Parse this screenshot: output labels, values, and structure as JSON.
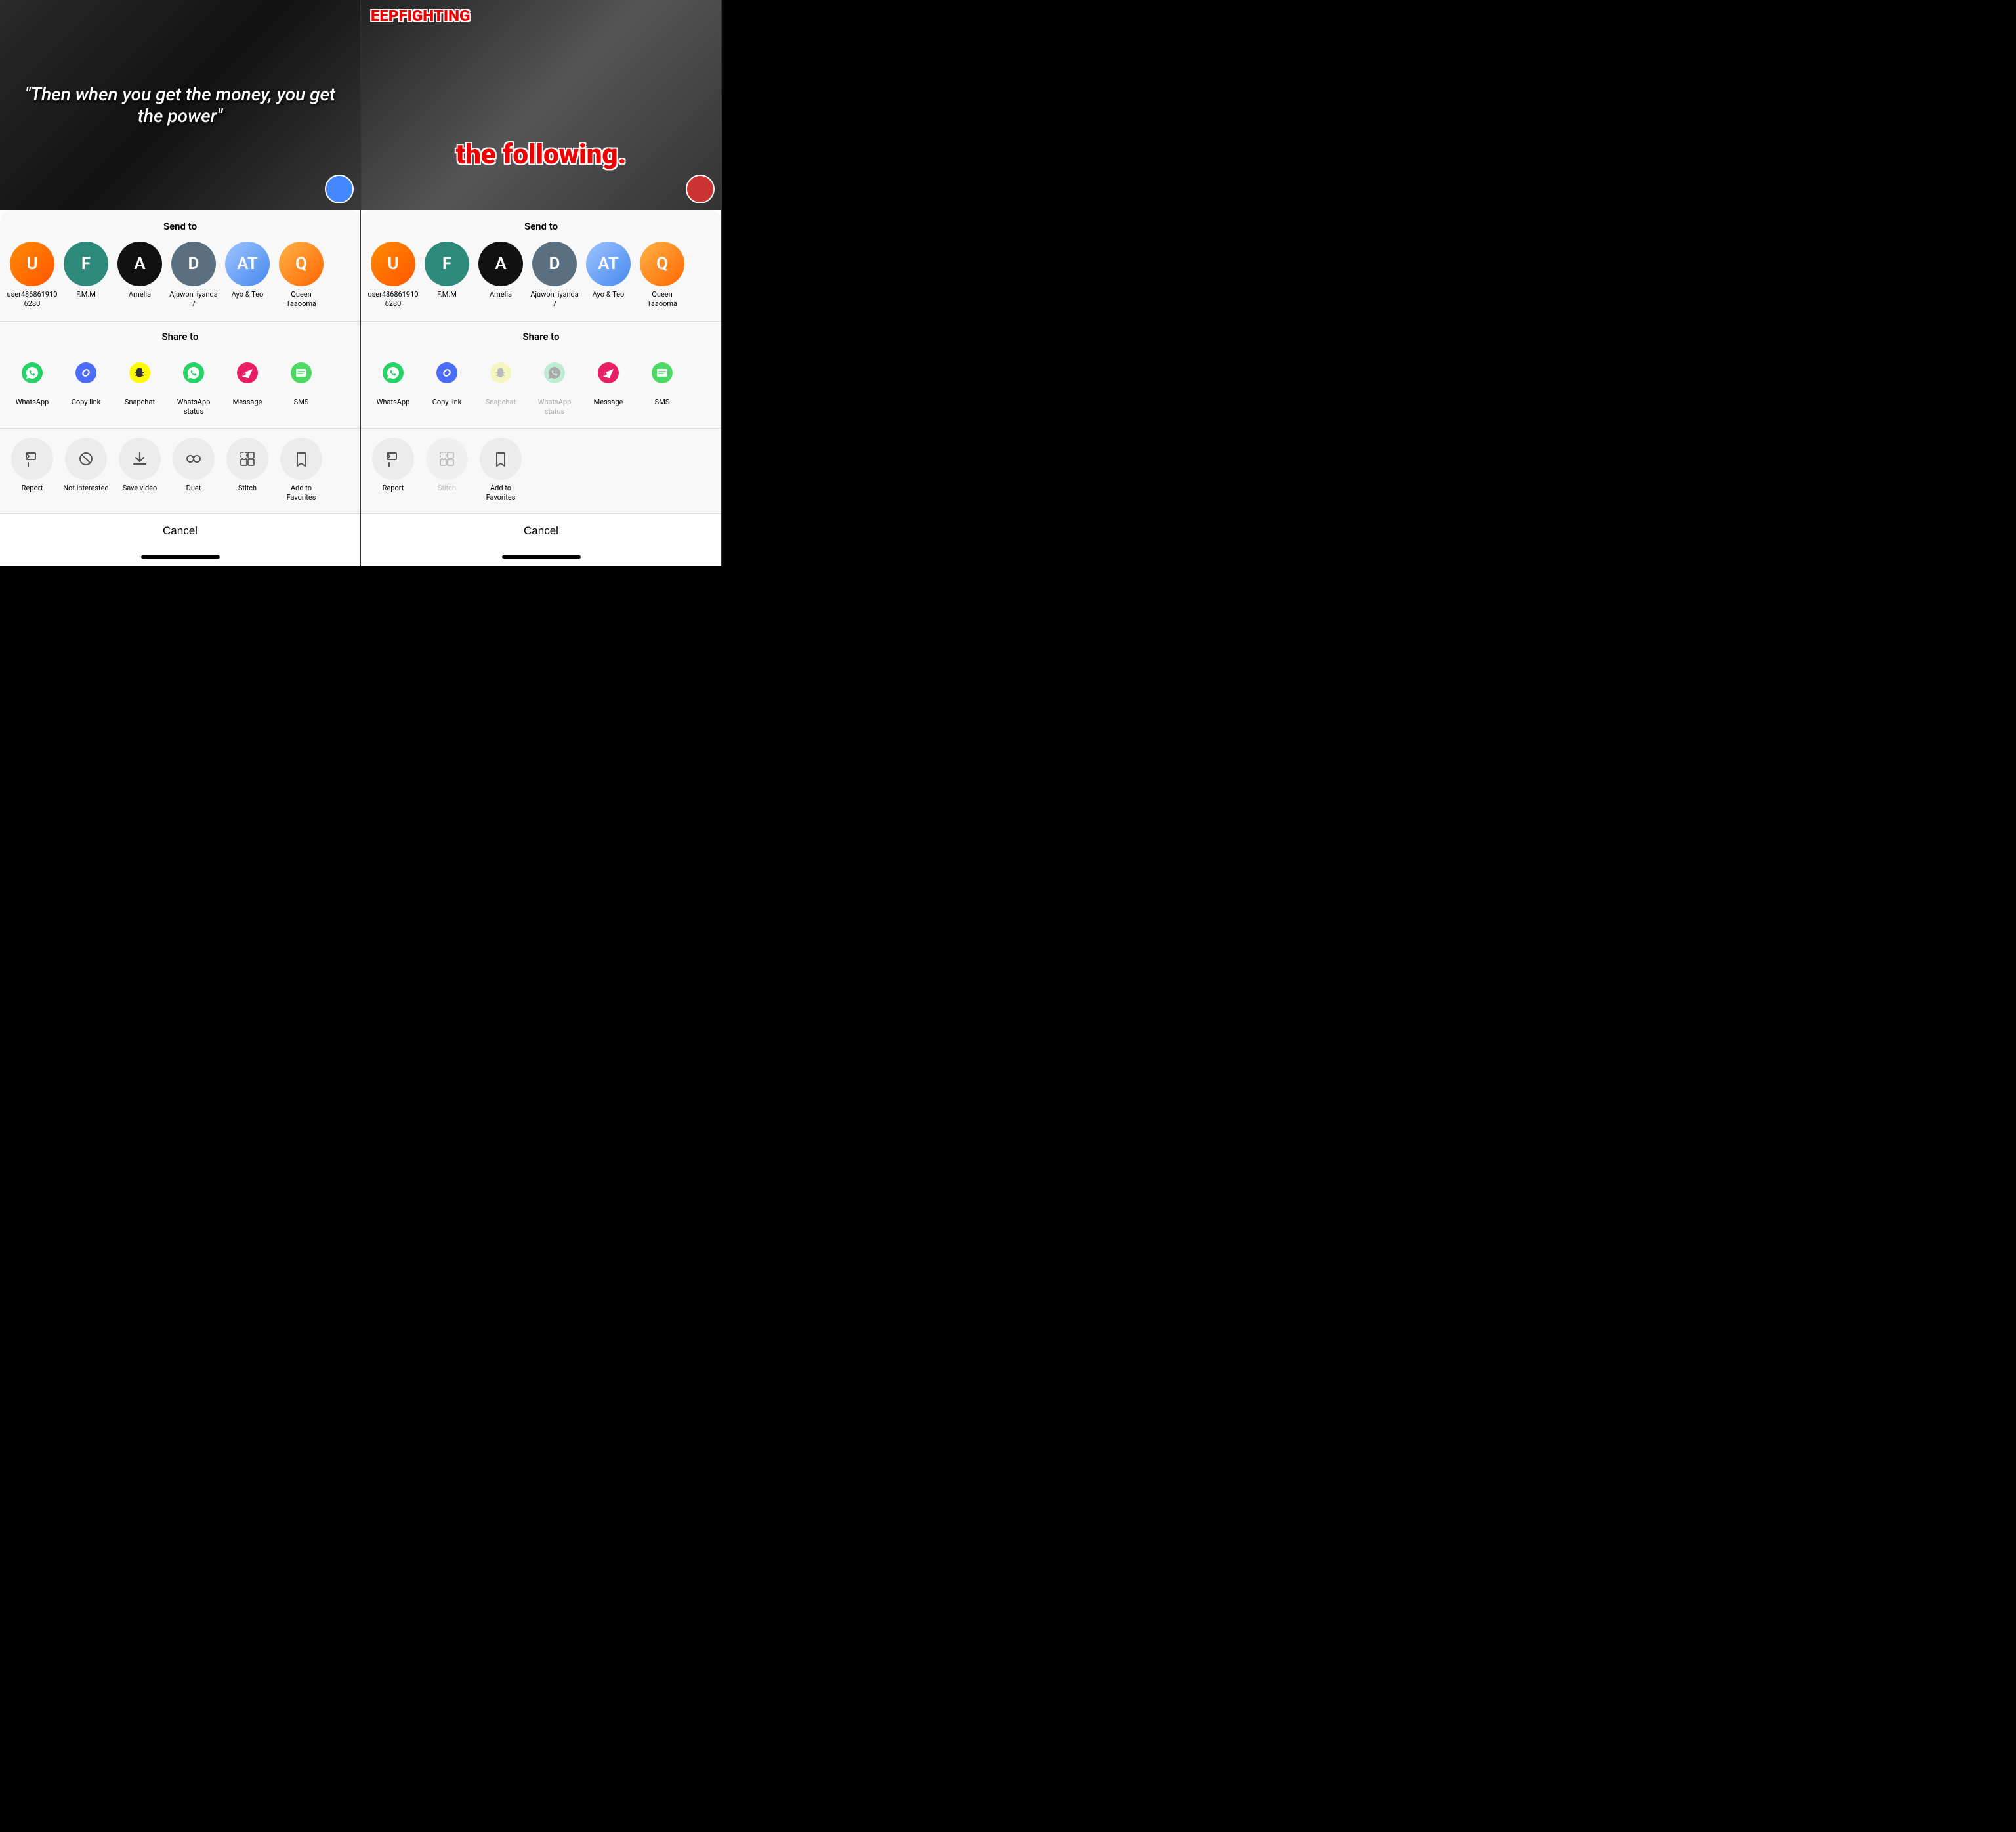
{
  "panels": [
    {
      "id": "left",
      "video": {
        "quote": "\"Then when you get the money, you get the power\"",
        "style": "dark"
      },
      "send_to_label": "Send to",
      "contacts": [
        {
          "name": "user4868619106280",
          "initials": "U",
          "color": "av-orange"
        },
        {
          "name": "F.M.M",
          "initials": "F",
          "color": "av-teal"
        },
        {
          "name": "Amelia",
          "initials": "A",
          "color": "av-black"
        },
        {
          "name": "Ajuwon_iyanda7",
          "initials": "D",
          "color": "av-slate"
        },
        {
          "name": "Ayo & Teo",
          "initials": "AT",
          "color": "av-photo1"
        },
        {
          "name": "Queen Taaoomä",
          "initials": "Q",
          "color": "av-photo2"
        }
      ],
      "share_to_label": "Share to",
      "share_items": [
        {
          "label": "WhatsApp",
          "icon": "whatsapp",
          "color": "ic-whatsapp",
          "disabled": false
        },
        {
          "label": "Copy link",
          "icon": "link",
          "color": "ic-copy",
          "disabled": false
        },
        {
          "label": "Snapchat",
          "icon": "snapchat",
          "color": "ic-snap",
          "disabled": false
        },
        {
          "label": "WhatsApp status",
          "icon": "whatsapp",
          "color": "ic-whatsapp-status",
          "disabled": false
        },
        {
          "label": "Message",
          "icon": "message",
          "color": "ic-message",
          "disabled": false
        },
        {
          "label": "SMS",
          "icon": "sms",
          "color": "ic-sms",
          "disabled": false
        }
      ],
      "actions": [
        {
          "label": "Report",
          "icon": "🚩",
          "disabled": false
        },
        {
          "label": "Not interested",
          "icon": "🤍",
          "disabled": false
        },
        {
          "label": "Save video",
          "icon": "↓",
          "disabled": false
        },
        {
          "label": "Duet",
          "icon": "⊙⊙",
          "disabled": false
        },
        {
          "label": "Stitch",
          "icon": "⊞",
          "disabled": false
        },
        {
          "label": "Add to Favorites",
          "icon": "🔖",
          "disabled": false
        }
      ],
      "cancel_label": "Cancel"
    },
    {
      "id": "right",
      "video": {
        "watermark": "EEPFIGHTING",
        "quote": "the following.",
        "style": "dark2"
      },
      "send_to_label": "Send to",
      "contacts": [
        {
          "name": "user4868619106280",
          "initials": "U",
          "color": "av-orange"
        },
        {
          "name": "F.M.M",
          "initials": "F",
          "color": "av-teal"
        },
        {
          "name": "Amelia",
          "initials": "A",
          "color": "av-black"
        },
        {
          "name": "Ajuwon_iyanda7",
          "initials": "D",
          "color": "av-slate"
        },
        {
          "name": "Ayo & Teo",
          "initials": "AT",
          "color": "av-photo1"
        },
        {
          "name": "Queen Taaoomä",
          "initials": "Q",
          "color": "av-photo2"
        }
      ],
      "share_to_label": "Share to",
      "share_items": [
        {
          "label": "WhatsApp",
          "icon": "whatsapp",
          "color": "ic-whatsapp",
          "disabled": false
        },
        {
          "label": "Copy link",
          "icon": "link",
          "color": "ic-copy",
          "disabled": false
        },
        {
          "label": "Snapchat",
          "icon": "snapchat",
          "color": "ic-snap-dim",
          "disabled": true
        },
        {
          "label": "WhatsApp status",
          "icon": "whatsapp",
          "color": "ic-whatsapp-dim",
          "disabled": true
        },
        {
          "label": "Message",
          "icon": "message",
          "color": "ic-message",
          "disabled": false
        },
        {
          "label": "SMS",
          "icon": "sms",
          "color": "ic-sms",
          "disabled": false
        }
      ],
      "actions": [
        {
          "label": "Report",
          "icon": "🚩",
          "disabled": false
        },
        {
          "label": "Stitch",
          "icon": "⊞",
          "disabled": true
        },
        {
          "label": "Add to Favorites",
          "icon": "🔖",
          "disabled": false
        }
      ],
      "cancel_label": "Cancel"
    }
  ]
}
